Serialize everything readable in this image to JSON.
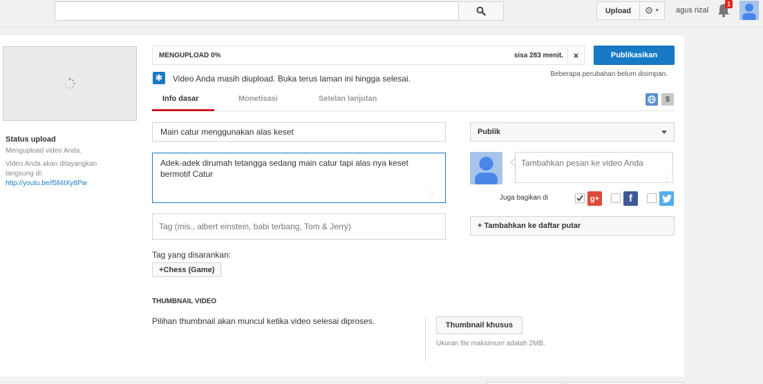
{
  "topbar": {
    "search_placeholder": "",
    "upload_label": "Upload",
    "username": "agus rizal",
    "notification_count": "1"
  },
  "sidebar": {
    "status_title": "Status upload",
    "status_sub": "Mengupload video Anda.",
    "live_text": "Video Anda akan ditayangkan langsung di:",
    "live_link": "http://youtu.be/l5ll4tXy8Pw"
  },
  "progress": {
    "label": "MENGUPLOAD 0%",
    "percent": 0,
    "remaining": "sisa 283 menit.",
    "close": "×"
  },
  "publish_label": "Publikasikan",
  "unsaved_text": "Beberapa perubahan belum disimpan.",
  "info_message": "Video Anda masih diupload. Buka terus laman ini hingga selesai.",
  "tabs": [
    {
      "label": "Info dasar"
    },
    {
      "label": "Monetisasi"
    },
    {
      "label": "Setelan lanjutan"
    }
  ],
  "form": {
    "title_value": "Main catur menggunakan alas keset",
    "description_value": "Adek-adek dirumah tetangga sedang main catur tapi alas nya keset bermotif Catur",
    "tag_placeholder": "Tag (mis., albert einstein, babi terbang, Tom & Jerry)",
    "suggested_label": "Tag yang disarankan:",
    "suggested_tags": [
      "+Chess (Game)"
    ]
  },
  "thumbnail": {
    "title": "THUMBNAIL VIDEO",
    "message": "Pilihan thumbnail akan muncul ketika video selesai diproses.",
    "custom_label": "Thumbnail khusus",
    "note": "Ukuran file maksimum adalah 2MB."
  },
  "privacy": {
    "selected": "Publik"
  },
  "share": {
    "placeholder": "Tambahkan pesan ke video Anda",
    "label": "Juga bagikan di",
    "gplus_checked": true,
    "facebook_checked": false,
    "twitter_checked": false
  },
  "playlist_label": "+ Tambahkan ke daftar putar",
  "colors": {
    "accent_blue": "#167ac6",
    "tab_red": "#cc181e",
    "gplus": "#dd4b39",
    "facebook": "#3b5998",
    "twitter": "#55acee"
  }
}
